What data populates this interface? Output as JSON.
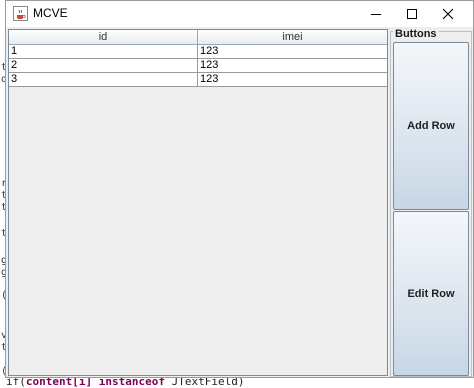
{
  "window": {
    "title": "MCVE",
    "icon": "java-coffee-icon",
    "controls": [
      "minimize-icon",
      "maximize-icon",
      "close-icon"
    ]
  },
  "table": {
    "columns": [
      "id",
      "imei"
    ],
    "rows": [
      [
        "1",
        "123"
      ],
      [
        "2",
        "123"
      ],
      [
        "3",
        "123"
      ]
    ]
  },
  "buttons_panel": {
    "title": "Buttons",
    "add_label": "Add Row",
    "edit_label": "Edit Row"
  },
  "background": {
    "bottom_code": [
      "if(",
      "content[i]",
      " ",
      "instanceof",
      " JTextField)"
    ]
  },
  "colors": {
    "window_bg": "#eeeeee",
    "button_gradient_top": "#f4f7fa",
    "button_gradient_bottom": "#c7d6e5"
  }
}
